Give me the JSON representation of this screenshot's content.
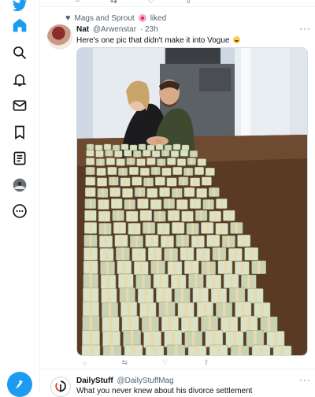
{
  "nav": {
    "items": [
      {
        "name": "twitter-logo-icon"
      },
      {
        "name": "home-icon"
      },
      {
        "name": "explore-icon"
      },
      {
        "name": "notifications-icon"
      },
      {
        "name": "messages-icon"
      },
      {
        "name": "bookmarks-icon"
      },
      {
        "name": "lists-icon"
      },
      {
        "name": "profile-icon"
      },
      {
        "name": "more-icon"
      }
    ],
    "accent": "#1d9bf0"
  },
  "social_context": {
    "text": "Mags and Sprout",
    "suffix": "liked"
  },
  "tweet": {
    "author_name": "Nat",
    "author_handle": "@Arwenstar",
    "time": "· 23h",
    "text": "Here's one pic that didn't make it into Vogue",
    "more_label": "···"
  },
  "next_tweet": {
    "author_name": "DailyStuff",
    "author_handle": "@DailyStuffMag",
    "text": "What you never knew about his divorce settlement",
    "more_label": "···"
  },
  "colors": {
    "text_primary": "#0f1419",
    "text_secondary": "#536471",
    "border": "#eff3f4"
  }
}
